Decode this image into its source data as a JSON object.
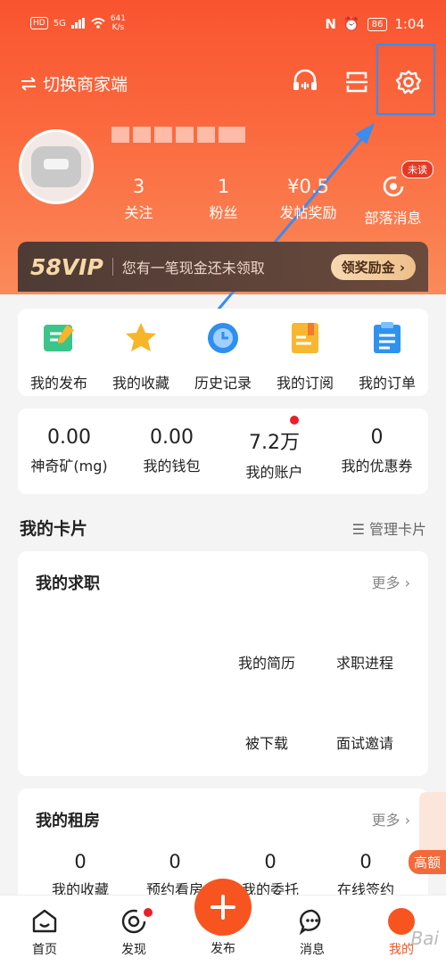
{
  "status": {
    "left_pill": "HD",
    "signal": "5G",
    "speed_top": "641",
    "speed_bottom": "K/s",
    "battery": "86",
    "time": "1:04"
  },
  "topbar": {
    "switch_label": "切换商家端"
  },
  "profile": {
    "stats": [
      {
        "value": "3",
        "label": "关注"
      },
      {
        "value": "1",
        "label": "粉丝"
      },
      {
        "value": "¥0.5",
        "label": "发帖奖励"
      },
      {
        "value": "",
        "label": "部落消息"
      }
    ],
    "unread_badge": "未读"
  },
  "vip": {
    "logo": "58VIP",
    "text": "您有一笔现金还未领取",
    "button": "领奖励金 ›"
  },
  "quick": [
    {
      "label": "我的发布",
      "icon": "publish-icon",
      "color": "#3cc48a"
    },
    {
      "label": "我的收藏",
      "icon": "star-icon",
      "color": "#f7b52a"
    },
    {
      "label": "历史记录",
      "icon": "clock-icon",
      "color": "#2f8ef0"
    },
    {
      "label": "我的订阅",
      "icon": "subscribe-icon",
      "color": "#f7b731"
    },
    {
      "label": "我的订单",
      "icon": "order-icon",
      "color": "#2f92ee"
    }
  ],
  "account": [
    {
      "value": "0.00",
      "label": "神奇矿(mg)"
    },
    {
      "value": "0.00",
      "label": "我的钱包"
    },
    {
      "value": "7.2万",
      "label": "我的账户"
    },
    {
      "value": "0",
      "label": "我的优惠券"
    }
  ],
  "cards_section": {
    "title": "我的卡片",
    "manage": "☰ 管理卡片"
  },
  "job_card": {
    "title": "我的求职",
    "more": "更多 ›",
    "items": [
      "我的简历",
      "求职进程",
      "被下载",
      "面试邀请"
    ]
  },
  "rent_card": {
    "title": "我的租房",
    "more": "更多 ›",
    "items": [
      {
        "value": "0",
        "label": "我的收藏"
      },
      {
        "value": "0",
        "label": "预约看房"
      },
      {
        "value": "0",
        "label": "我的委托"
      },
      {
        "value": "0",
        "label": "在线签约"
      }
    ]
  },
  "side_ad": {
    "label": "高额"
  },
  "tabs": [
    {
      "label": "首页"
    },
    {
      "label": "发现"
    },
    {
      "label": "发布"
    },
    {
      "label": "消息"
    },
    {
      "label": "我的"
    }
  ],
  "watermark": "Bai"
}
